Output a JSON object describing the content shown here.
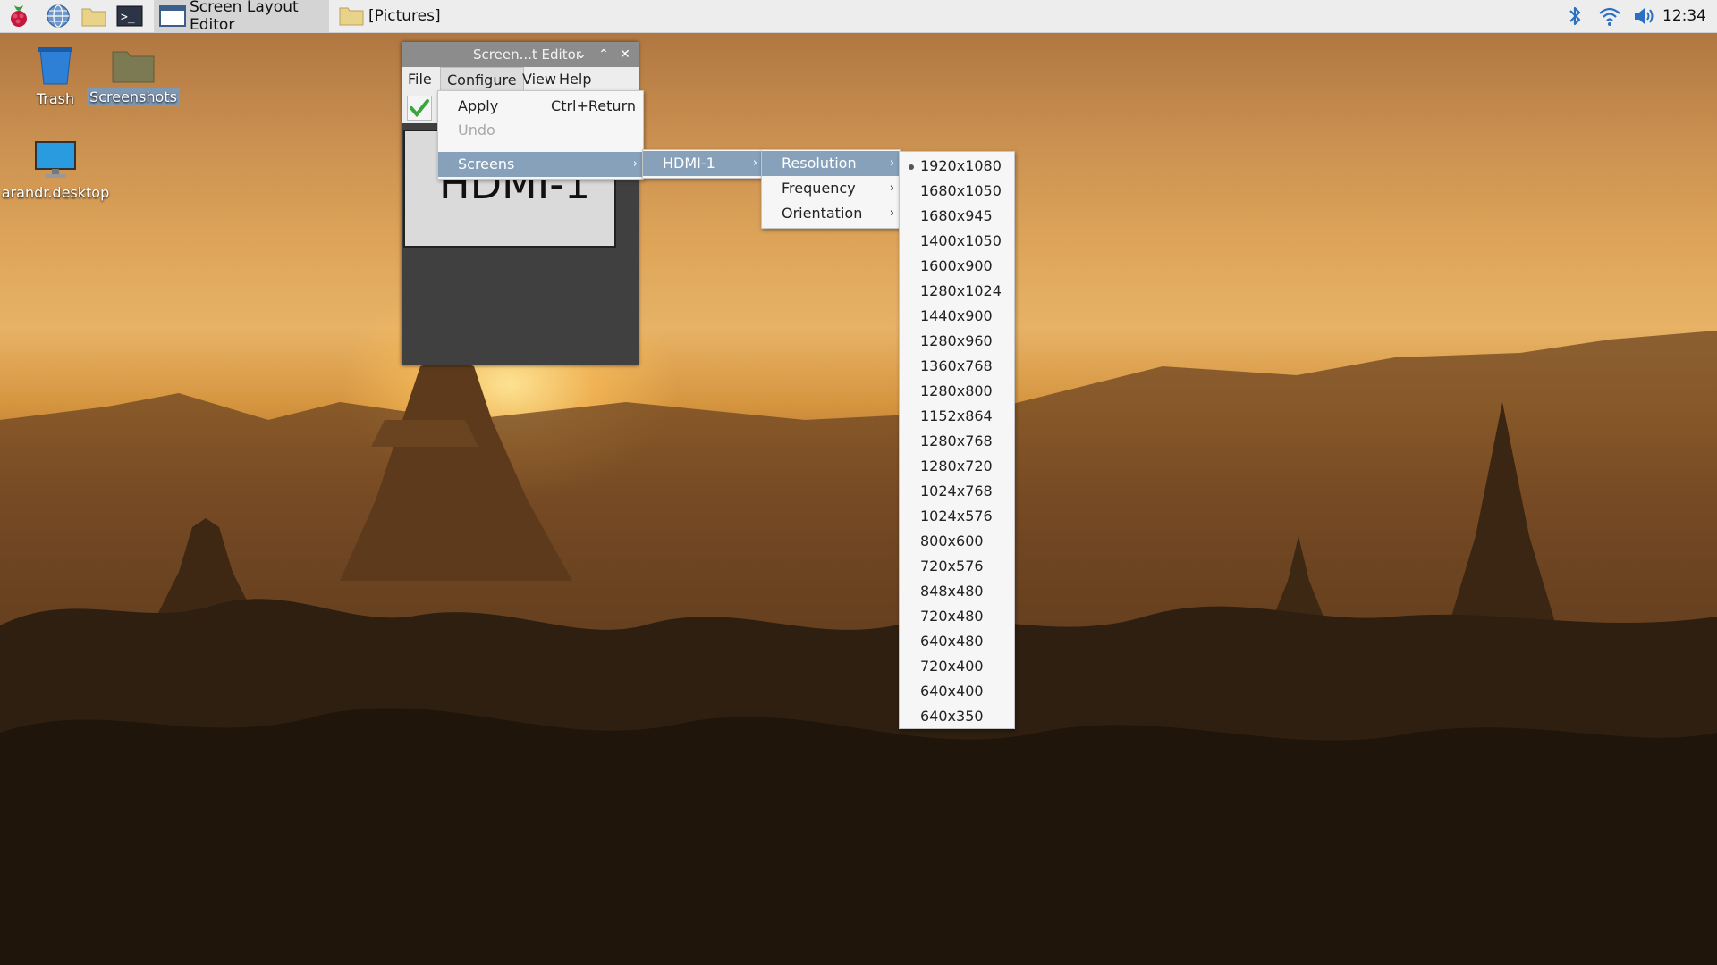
{
  "taskbar": {
    "tasks": [
      {
        "label": "Screen Layout Editor"
      },
      {
        "label": "[Pictures]"
      }
    ],
    "clock": "12:34"
  },
  "desktop_icons": [
    {
      "label": "Trash"
    },
    {
      "label": "Screenshots"
    },
    {
      "label": "arandr.desktop"
    }
  ],
  "window": {
    "title": "Screen...t Editor",
    "menus": [
      "File",
      "Configure",
      "View",
      "Help"
    ],
    "screen_label": "HDMI-1"
  },
  "configure_menu": {
    "apply": "Apply",
    "apply_shortcut": "Ctrl+Return",
    "undo": "Undo",
    "screens": "Screens"
  },
  "screens_menu": {
    "output": "HDMI-1"
  },
  "output_menu": {
    "items": [
      "Resolution",
      "Frequency",
      "Orientation"
    ]
  },
  "resolution_menu": {
    "selected": "1920x1080",
    "items": [
      "1920x1080",
      "1680x1050",
      "1680x945",
      "1400x1050",
      "1600x900",
      "1280x1024",
      "1440x900",
      "1280x960",
      "1360x768",
      "1280x800",
      "1152x864",
      "1280x768",
      "1280x720",
      "1024x768",
      "1024x576",
      "800x600",
      "720x576",
      "848x480",
      "720x480",
      "640x480",
      "720x400",
      "640x400",
      "640x350"
    ]
  },
  "colors": {
    "menu_highlight": "#87a1ba",
    "taskbar_bg": "#ededed"
  }
}
